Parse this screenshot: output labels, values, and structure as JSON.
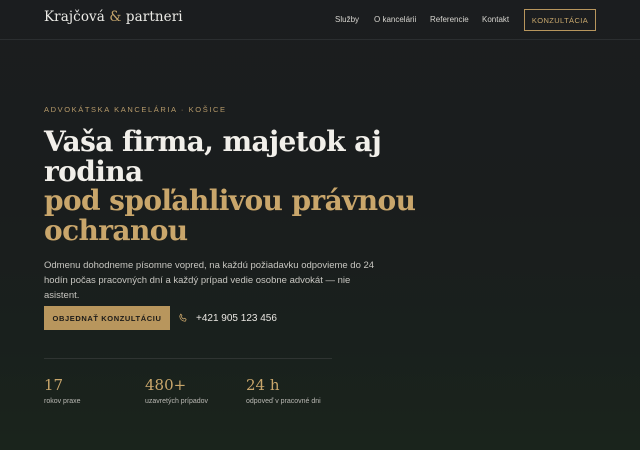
{
  "nav": {
    "logo_name": "Krajčová",
    "logo_amp": "&",
    "logo_rest": "partneri",
    "items": [
      {
        "label": "Služby"
      },
      {
        "label": "O kancelárii"
      },
      {
        "label": "Referencie"
      },
      {
        "label": "Kontakt"
      }
    ],
    "cta_label": "KONZULTÁCIA"
  },
  "hero": {
    "eyebrow": "ADVOKÁTSKA KANCELÁRIA · KOŠICE",
    "headline_line1": "Vaša firma, majetok aj",
    "headline_line2": "rodina",
    "headline_accent_line1": "pod spoľahlivou právnou",
    "headline_accent_line2": "ochranou",
    "lead": "Odmenu dohodneme písomne vopred, na každú požiadavku odpovieme do 24 hodín počas pracovných dní a každý prípad vedie osobne advokát — nie asistent.",
    "primary_button": "OBJEDNAŤ KONZULTÁCIU",
    "phone": "+421 905 123 456"
  },
  "stats": [
    {
      "value": "17",
      "label": "rokov praxe"
    },
    {
      "value": "480+",
      "label": "uzavretých prípadov"
    },
    {
      "value": "24 h",
      "label": "odpoveď v pracovné dni"
    }
  ],
  "colors": {
    "accent": "#c9a66b",
    "background": "#1b1d1f"
  }
}
